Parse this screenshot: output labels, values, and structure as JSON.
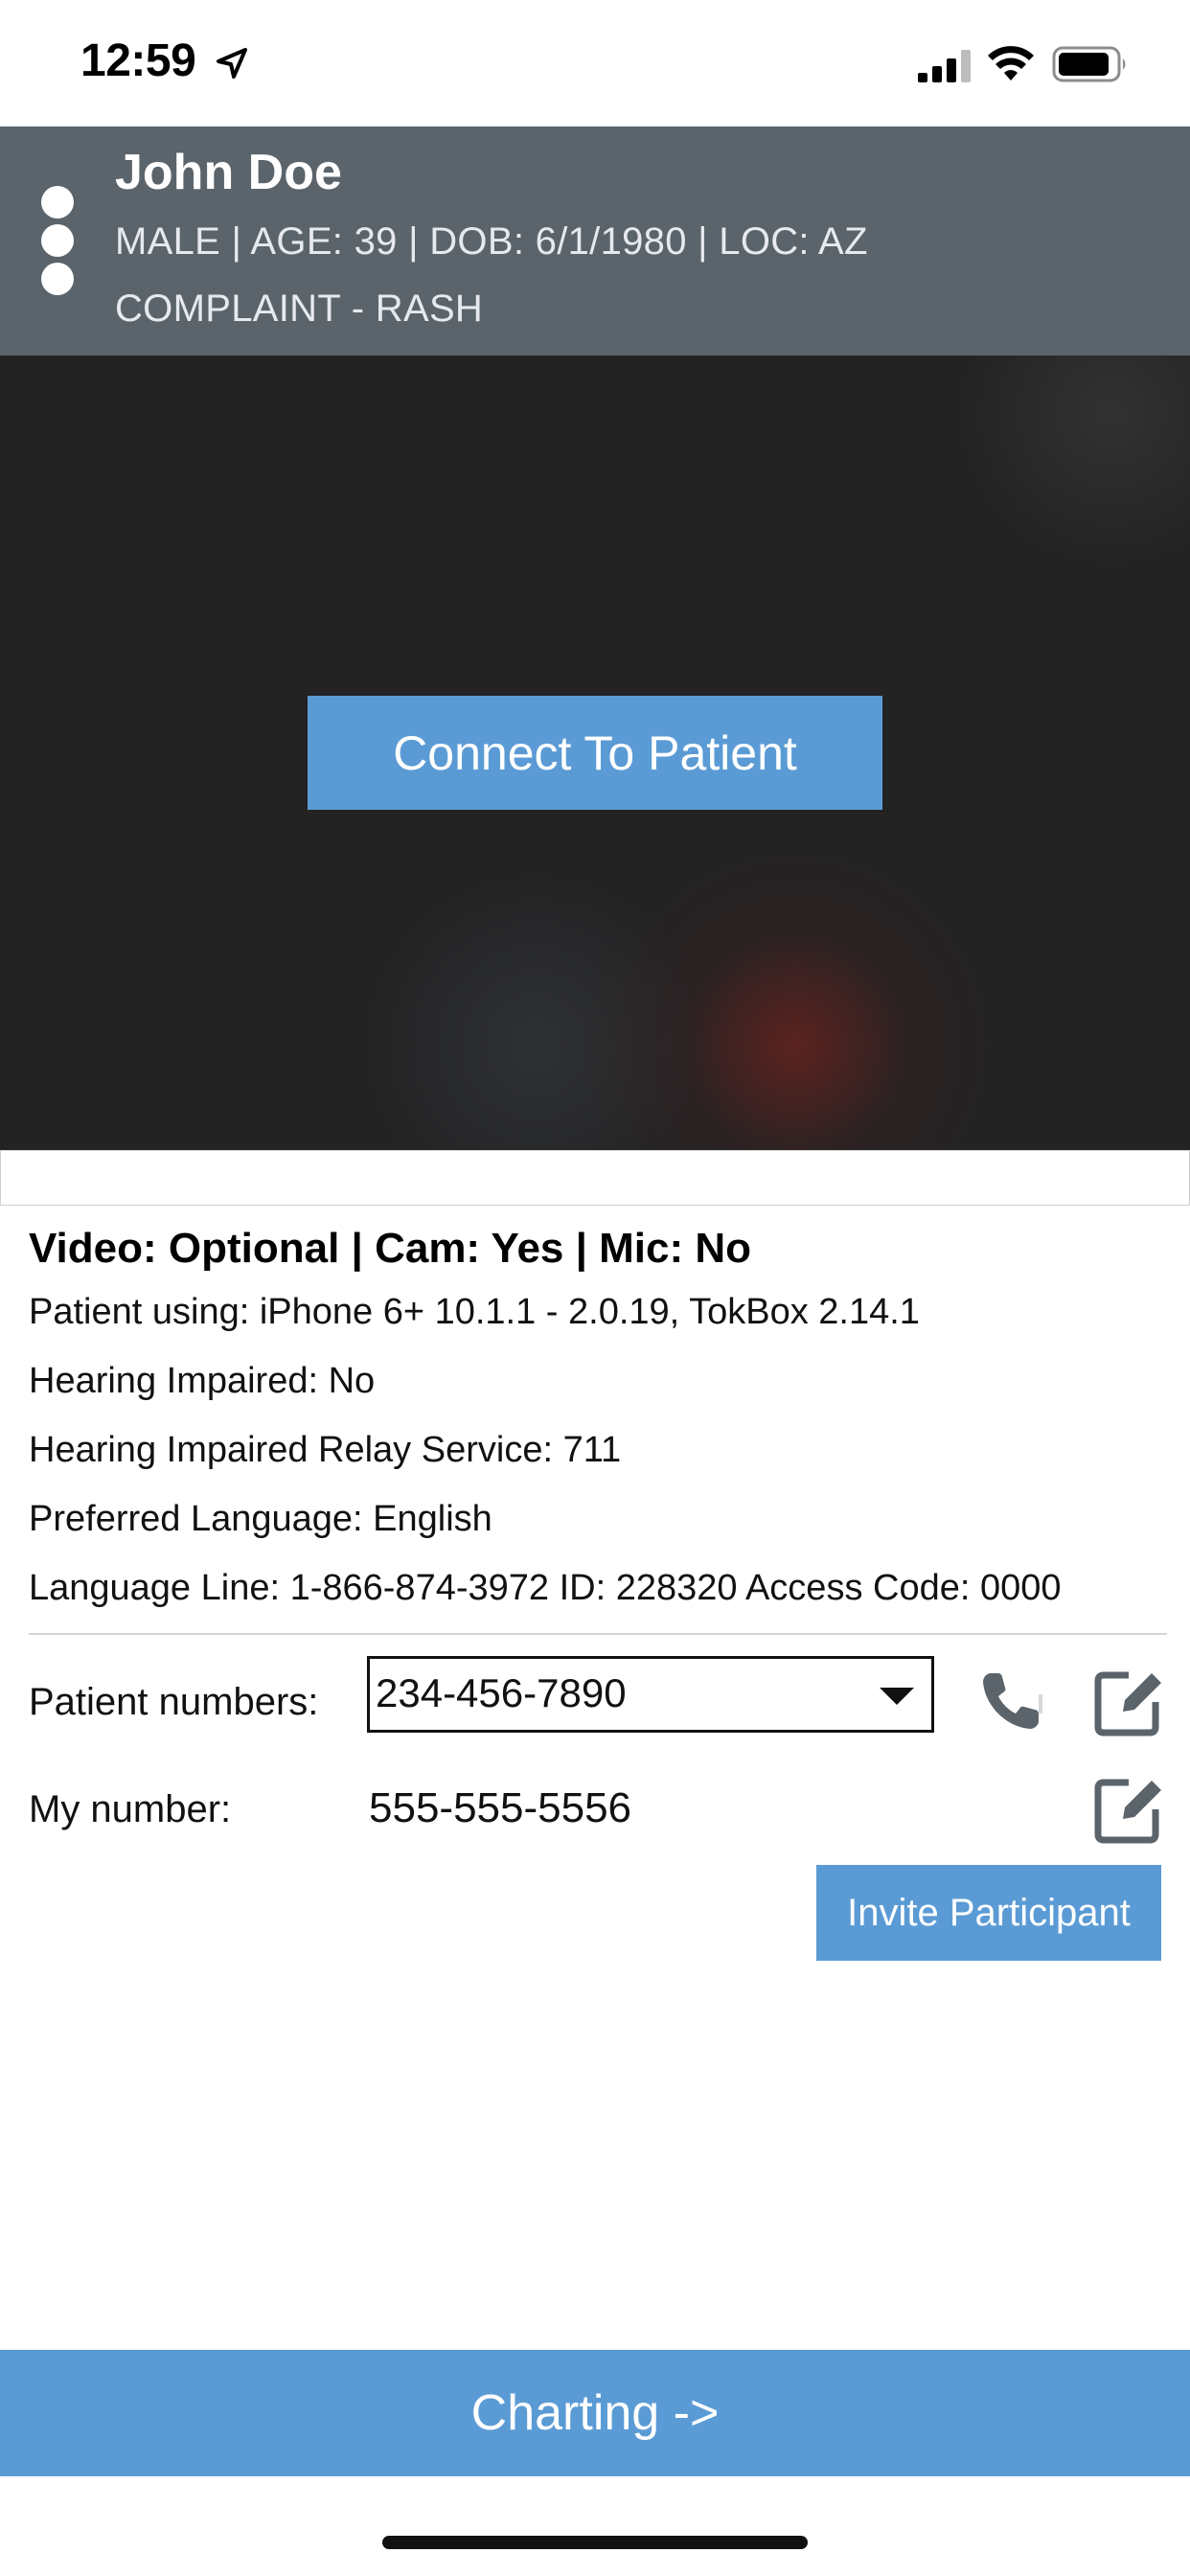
{
  "status_bar": {
    "time": "12:59",
    "icons": [
      "location-arrow-icon",
      "cellular-signal-icon",
      "wifi-icon",
      "battery-icon"
    ]
  },
  "patient": {
    "name": "John Doe",
    "info": "MALE | AGE: 39 | DOB: 6/1/1980 | LOC: AZ",
    "complaint": "COMPLAINT - RASH"
  },
  "video": {
    "connect_label": "Connect To Patient"
  },
  "details": {
    "video_status": "Video: Optional | Cam: Yes | Mic: No",
    "patient_using": "Patient using: iPhone 6+ 10.1.1 - 2.0.19, TokBox 2.14.1",
    "hearing_impaired": "Hearing Impaired: No",
    "relay_service": "Hearing Impaired Relay Service: 711",
    "preferred_language": "Preferred Language: English",
    "language_line": "Language Line: 1-866-874-3972 ID: 228320 Access Code: 0000"
  },
  "numbers": {
    "patient_label": "Patient numbers:",
    "patient_selected": "234-456-7890",
    "my_label": "My number:",
    "my_value": "555-555-5556"
  },
  "actions": {
    "invite_label": "Invite Participant",
    "charting_label": "Charting ->"
  },
  "colors": {
    "header_bg": "#5b646b",
    "accent_blue": "#5b9bd5",
    "video_bg": "#232324"
  }
}
